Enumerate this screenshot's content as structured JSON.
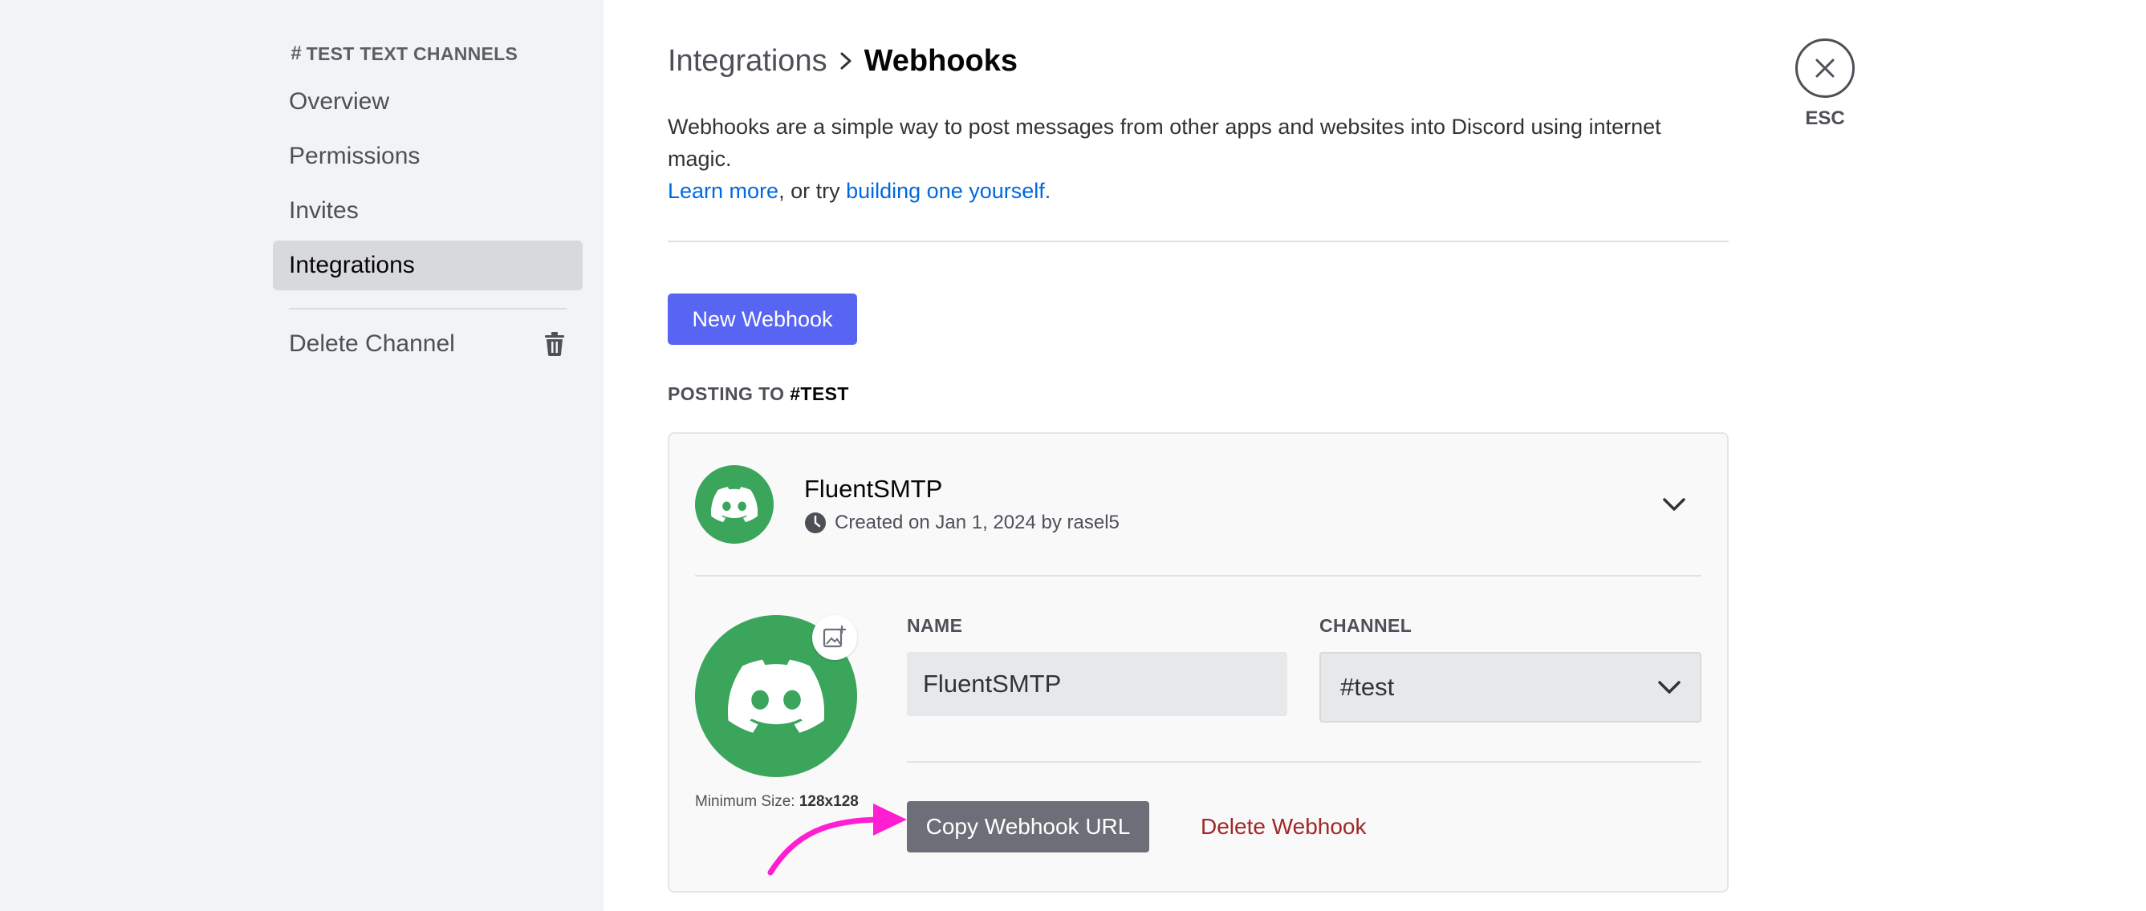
{
  "sidebar": {
    "section_header": "TEST TEXT CHANNELS",
    "items": [
      {
        "label": "Overview"
      },
      {
        "label": "Permissions"
      },
      {
        "label": "Invites"
      },
      {
        "label": "Integrations",
        "selected": true
      }
    ],
    "delete_label": "Delete Channel",
    "delete_icon": "trash-icon"
  },
  "header": {
    "parent": "Integrations",
    "current": "Webhooks"
  },
  "description": {
    "text": "Webhooks are a simple way to post messages from other apps and websites into Discord using internet magic.",
    "learn_more": "Learn more",
    "middle": ", or try ",
    "building_link": "building one yourself."
  },
  "new_webhook_label": "New Webhook",
  "posting": {
    "prefix": "POSTING TO ",
    "channel": "#TEST"
  },
  "webhook": {
    "name": "FluentSMTP",
    "created": "Created on Jan 1, 2024 by rasel5",
    "name_label": "NAME",
    "name_value": "FluentSMTP",
    "channel_label": "CHANNEL",
    "channel_value": "#test",
    "min_size_label": "Minimum Size: ",
    "min_size_value": "128x128",
    "copy_label": "Copy Webhook URL",
    "delete_label": "Delete Webhook"
  },
  "close": {
    "label": "ESC"
  },
  "colors": {
    "brand": "#5865f2",
    "avatar_green": "#3ba55c",
    "link": "#0068e0",
    "danger": "#a12828",
    "annotation_arrow": "#ff1ed2"
  }
}
